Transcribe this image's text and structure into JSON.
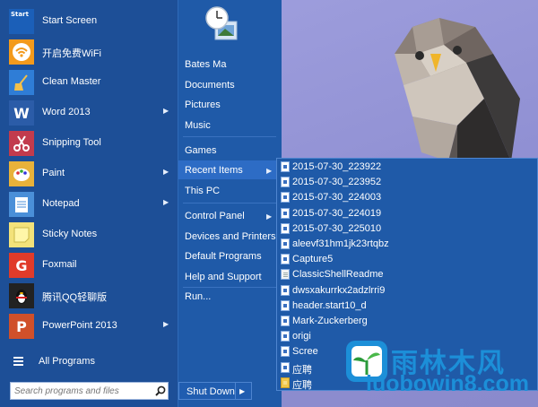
{
  "programs": [
    {
      "label": "Start Screen",
      "tile_text": "Start",
      "icon": "start-screen-icon",
      "color": "#1b5fb8",
      "arrow": false
    },
    {
      "label": "开启免费WiFi",
      "tile_text": "",
      "icon": "wifi-icon",
      "color": "#f39a1c",
      "arrow": false
    },
    {
      "label": "Clean Master",
      "tile_text": "",
      "icon": "broom-icon",
      "color": "#2f7dd6",
      "arrow": false
    },
    {
      "label": "Word 2013",
      "tile_text": "W",
      "icon": "word-icon",
      "color": "#2b5ca8",
      "arrow": true
    },
    {
      "label": "Snipping Tool",
      "tile_text": "",
      "icon": "scissors-icon",
      "color": "#c23b4d",
      "arrow": false
    },
    {
      "label": "Paint",
      "tile_text": "",
      "icon": "palette-icon",
      "color": "#e8b23a",
      "arrow": true
    },
    {
      "label": "Notepad",
      "tile_text": "",
      "icon": "notepad-icon",
      "color": "#4a8fd8",
      "arrow": true
    },
    {
      "label": "Sticky Notes",
      "tile_text": "",
      "icon": "sticky-note-icon",
      "color": "#f3e27a",
      "arrow": false
    },
    {
      "label": "Foxmail",
      "tile_text": "G",
      "icon": "foxmail-icon",
      "color": "#e03b2a",
      "arrow": false
    },
    {
      "label": "腾讯QQ轻聊版",
      "tile_text": "",
      "icon": "qq-penguin-icon",
      "color": "#222222",
      "arrow": false
    },
    {
      "label": "PowerPoint 2013",
      "tile_text": "P",
      "icon": "powerpoint-icon",
      "color": "#d0502a",
      "arrow": true
    }
  ],
  "all_programs": {
    "label": "All Programs"
  },
  "search": {
    "placeholder": "Search programs and files"
  },
  "right": {
    "links": [
      {
        "label": "Bates Ma",
        "arrow": false
      },
      {
        "label": "Documents",
        "arrow": false
      },
      {
        "label": "Pictures",
        "arrow": false
      },
      {
        "label": "Music",
        "arrow": false
      },
      {
        "label": "Games",
        "arrow": false
      },
      {
        "label": "Recent Items",
        "arrow": true
      },
      {
        "label": "This PC",
        "arrow": false
      },
      {
        "label": "Control Panel",
        "arrow": true
      },
      {
        "label": "Devices and Printers",
        "arrow": false
      },
      {
        "label": "Default Programs",
        "arrow": false
      },
      {
        "label": "Help and Support",
        "arrow": false
      },
      {
        "label": "Run...",
        "arrow": false
      }
    ],
    "shutdown_label": "Shut Down"
  },
  "recent_items": [
    {
      "label": "2015-07-30_223922",
      "type": "image"
    },
    {
      "label": "2015-07-30_223952",
      "type": "image"
    },
    {
      "label": "2015-07-30_224003",
      "type": "image"
    },
    {
      "label": "2015-07-30_224019",
      "type": "image"
    },
    {
      "label": "2015-07-30_225010",
      "type": "image"
    },
    {
      "label": "aleevf31hm1jk23rtqbz",
      "type": "image"
    },
    {
      "label": "Capture5",
      "type": "image"
    },
    {
      "label": "ClassicShellReadme",
      "type": "text"
    },
    {
      "label": "dwsxakurrkx2adzlrri9",
      "type": "image"
    },
    {
      "label": "header.start10_d",
      "type": "image"
    },
    {
      "label": "Mark-Zuckerberg",
      "type": "image"
    },
    {
      "label": "origi",
      "type": "image"
    },
    {
      "label": "Scree",
      "type": "image"
    },
    {
      "label": "应聘",
      "type": "image"
    },
    {
      "label": "应聘",
      "type": "folder"
    }
  ],
  "watermark": {
    "title": "雨林木风",
    "url": "luobowin8.com"
  }
}
